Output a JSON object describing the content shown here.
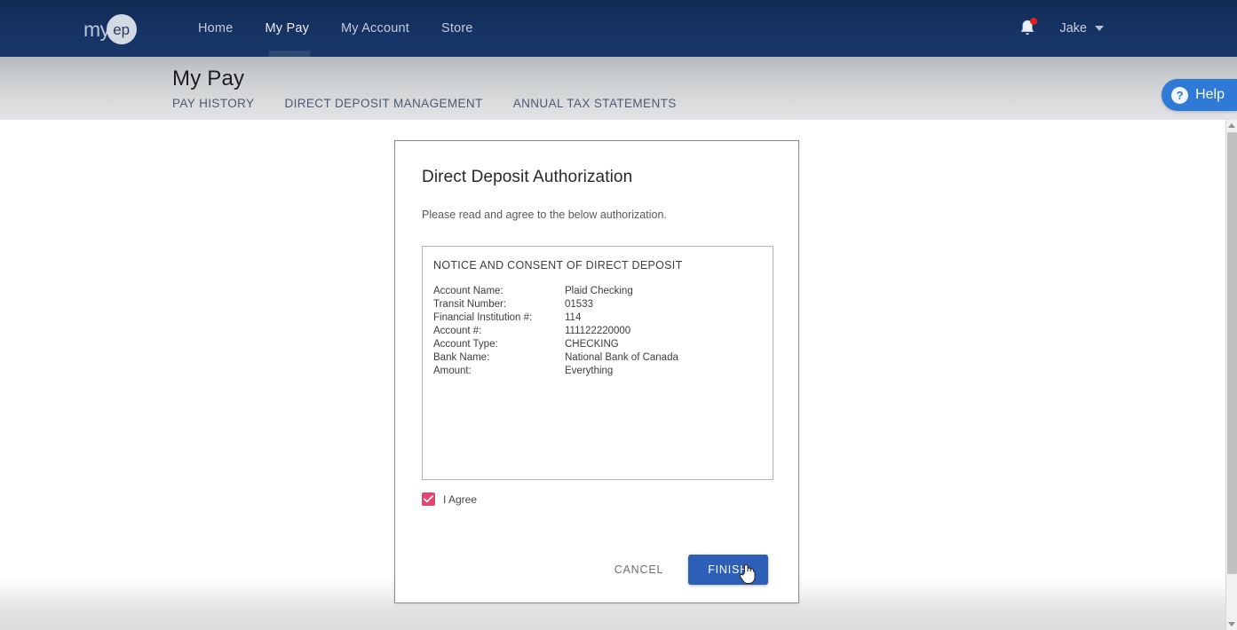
{
  "topbar": {
    "logo": {
      "prefix": "my",
      "mark": "ep"
    },
    "nav": [
      {
        "label": "Home",
        "active": false
      },
      {
        "label": "My Pay",
        "active": true
      },
      {
        "label": "My Account",
        "active": false
      },
      {
        "label": "Store",
        "active": false
      }
    ],
    "notifications_icon": "bell-icon",
    "user": {
      "name": "Jake",
      "chevron": "chevron-down-icon"
    },
    "colors": {
      "bar_bg": "#163364",
      "badge": "#e02020"
    }
  },
  "subheader": {
    "title": "My Pay",
    "tabs": [
      {
        "label": "PAY HISTORY"
      },
      {
        "label": "DIRECT DEPOSIT MANAGEMENT"
      },
      {
        "label": "ANNUAL TAX STATEMENTS"
      }
    ]
  },
  "help": {
    "label": "Help",
    "icon": "question-mark-icon",
    "glyph": "?",
    "color": "#2e7ad6"
  },
  "modal": {
    "title": "Direct Deposit Authorization",
    "subtitle": "Please read and agree to the below authorization.",
    "notice": {
      "heading": "NOTICE AND CONSENT OF DIRECT DEPOSIT",
      "rows": [
        {
          "key": "Account Name:",
          "value": "Plaid Checking"
        },
        {
          "key": "Transit Number:",
          "value": "01533"
        },
        {
          "key": "Financial Institution #:",
          "value": "114"
        },
        {
          "key": "Account #:",
          "value": "111122220000"
        },
        {
          "key": "Account Type:",
          "value": "CHECKING"
        },
        {
          "key": "Bank Name:",
          "value": "National Bank of Canada"
        },
        {
          "key": "Amount:",
          "value": "Everything"
        }
      ]
    },
    "agree": {
      "label": "I Agree",
      "checked": true,
      "checkbox_color": "#e8436c"
    },
    "buttons": {
      "cancel": "CANCEL",
      "finish": "FINISH",
      "finish_color": "#2c5fb5"
    }
  },
  "cursor": {
    "type": "pointer-hand-cursor"
  },
  "scrollbar": {
    "up": "scroll-up-arrow",
    "down": "scroll-down-arrow"
  }
}
